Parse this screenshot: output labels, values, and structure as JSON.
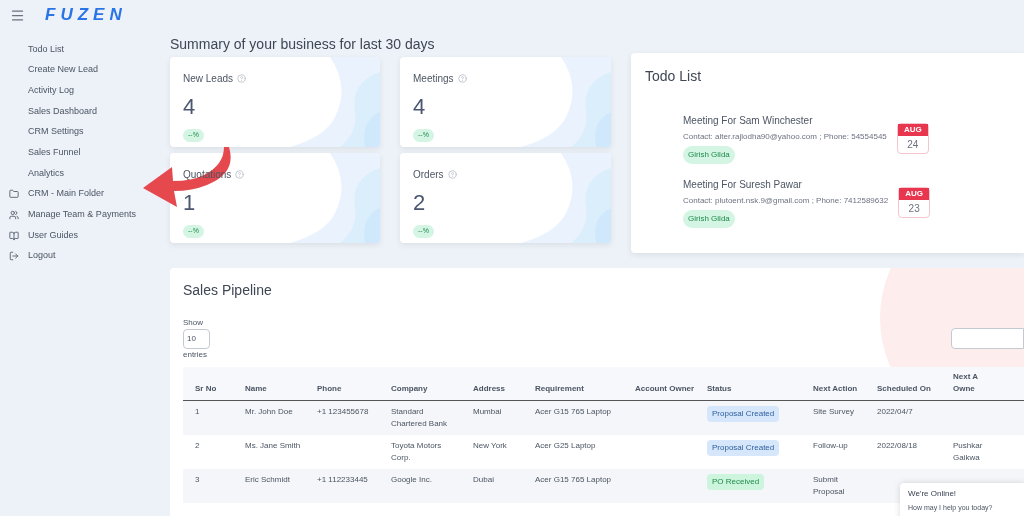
{
  "brand": "FUZEN",
  "sidebar": {
    "items": [
      {
        "label": "Todo List",
        "kind": "page"
      },
      {
        "label": "Create New Lead",
        "kind": "page"
      },
      {
        "label": "Activity Log",
        "kind": "page"
      },
      {
        "label": "Sales Dashboard",
        "kind": "page"
      },
      {
        "label": "CRM Settings",
        "kind": "page"
      },
      {
        "label": "Sales Funnel",
        "kind": "page"
      },
      {
        "label": "Analytics",
        "kind": "page"
      },
      {
        "label": "CRM - Main Folder",
        "kind": "folder"
      },
      {
        "label": "Manage Team & Payments",
        "kind": "team"
      },
      {
        "label": "User Guides",
        "kind": "guide"
      },
      {
        "label": "Logout",
        "kind": "logout"
      }
    ]
  },
  "summary": {
    "title": "Summary of your business for last 30 days",
    "cards": [
      {
        "label": "New Leads",
        "value": "4",
        "change": "--%"
      },
      {
        "label": "Meetings",
        "value": "4",
        "change": "--%"
      },
      {
        "label": "Quotations",
        "value": "1",
        "change": "--%"
      },
      {
        "label": "Orders",
        "value": "2",
        "change": "--%"
      }
    ]
  },
  "todo": {
    "title": "Todo List",
    "items": [
      {
        "title": "Meeting For Sam Winchester",
        "contact": "Contact: alter.rajlodha90@yahoo.com ; Phone: 54554545",
        "owner": "Girish Gilda",
        "month": "AUG",
        "day": "24"
      },
      {
        "title": "Meeting For Suresh Pawar",
        "contact": "Contact: plutoent.nsk.9@gmail.com ; Phone: 7412589632",
        "owner": "Girish Gilda",
        "month": "AUG",
        "day": "23"
      }
    ]
  },
  "pipeline": {
    "title": "Sales Pipeline",
    "show_label": "Show",
    "page_size": "10",
    "entries_label": "entries",
    "columns": [
      "Sr No",
      "Name",
      "Phone",
      "Company",
      "Address",
      "Requirement",
      "Account Owner",
      "Status",
      "Next Action",
      "Scheduled On",
      "Next A\nOwne"
    ],
    "rows": [
      {
        "cells": [
          "1",
          "Mr. John Doe",
          "+1 123455678",
          "Standard Chartered Bank",
          "Mumbai",
          "Acer G15 765 Laptop",
          "",
          "Proposal Created",
          "Site Survey",
          "2022/04/7",
          ""
        ],
        "kind": "proposal"
      },
      {
        "cells": [
          "2",
          "Ms. Jane Smith",
          "",
          "Toyota Motors Corp.",
          "New York",
          "Acer G25 Laptop",
          "",
          "Proposal Created",
          "Follow-up",
          "2022/08/18",
          "Pushkar\nGaikwa"
        ],
        "kind": "proposal"
      },
      {
        "cells": [
          "3",
          "Eric Schmidt",
          "+1 112233445",
          "Google Inc.",
          "Dubai",
          "Acer G15 765 Laptop",
          "",
          "PO Received",
          "Submit Proposal",
          "",
          ""
        ],
        "kind": "received"
      }
    ]
  },
  "chat": {
    "title": "We're Online!",
    "message": "How may I help you today?"
  }
}
